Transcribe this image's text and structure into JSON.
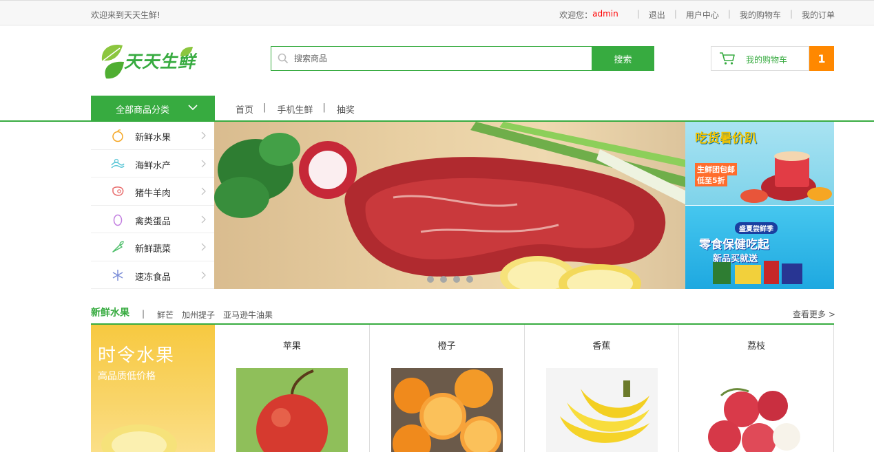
{
  "topbar": {
    "welcome": "欢迎来到天天生鲜!",
    "greeting": "欢迎您：",
    "username": "admin",
    "links": [
      "退出",
      "用户中心",
      "我的购物车",
      "我的订单"
    ]
  },
  "header": {
    "logo_text": "天天生鲜",
    "search_placeholder": "搜索商品",
    "search_button": "搜索",
    "cart_label": "我的购物车",
    "cart_count": "1"
  },
  "nav": {
    "category_button": "全部商品分类",
    "links": [
      "首页",
      "手机生鲜",
      "抽奖"
    ]
  },
  "categories": [
    {
      "label": "新鲜水果",
      "icon": "fruit-icon"
    },
    {
      "label": "海鲜水产",
      "icon": "seafood-icon"
    },
    {
      "label": "猪牛羊肉",
      "icon": "meat-icon"
    },
    {
      "label": "禽类蛋品",
      "icon": "egg-icon"
    },
    {
      "label": "新鲜蔬菜",
      "icon": "vegetable-icon"
    },
    {
      "label": "速冻食品",
      "icon": "snowflake-icon"
    }
  ],
  "ads": {
    "ad1_title": "吃货暑价趴",
    "ad1_line1": "生鲜团包邮",
    "ad1_line2": "低至5折",
    "ad2_badge": "盛夏尝鲜季",
    "ad2_title": "零食保健吃起",
    "ad2_sub": "新品买就送"
  },
  "section": {
    "title": "新鲜水果",
    "tags": [
      "鲜芒",
      "加州提子",
      "亚马逊牛油果"
    ],
    "more": "查看更多 >",
    "promo_title": "时令水果",
    "promo_sub": "高品质低价格",
    "products": [
      {
        "name": "苹果"
      },
      {
        "name": "橙子"
      },
      {
        "name": "香蕉"
      },
      {
        "name": "荔枝"
      }
    ]
  },
  "colors": {
    "brand_green": "#37ab40",
    "cart_badge_orange": "#ff8800",
    "username_red": "#ff0000"
  }
}
